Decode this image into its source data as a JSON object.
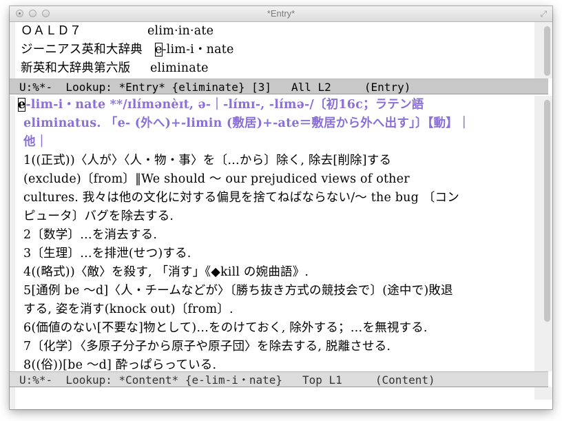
{
  "window": {
    "title": "*Entry*",
    "resize_icon": "resize-diagonal-icon"
  },
  "entry_pane": {
    "lines": [
      {
        "dict": "ＯＡＬＤ７",
        "word": "elim·in·ate"
      },
      {
        "dict": "ジーニアス英和大辞典",
        "word_cursor": "e",
        "word": "-lim-i・nate"
      },
      {
        "dict": "新英和大辞典第六版",
        "word": "eliminate"
      }
    ]
  },
  "modeline_entry": "U:%*-  Lookup: *Entry* {eliminate} [3]   All L2     (Entry)",
  "content_pane": {
    "head_cursor": "e",
    "head_rest": "-lim-i・nate **/ɪlímənèɪt, ə-｜-lɪ́mɪ-, -lɪ́mə-/〔初16c；ラテン語",
    "etym_line1": "eliminatus. 「e- (外へ)+-limin (敷居)+-ate＝敷居から外へ出す」〕【動】｜",
    "etym_line2": "他｜",
    "body_lines": [
      "1((正式))〈人が〉〈人・物・事〉を〔…から〕除く, 除去[削除]する",
      "(exclude)〔from〕‖We should 〜 our prejudiced views of other",
      "cultures. 我々は他の文化に対する偏見を捨てねばならない/〜 the bug 〔コン",
      "ピュータ〕バグを除去する.",
      "2〔数学〕…を消去する.",
      "3〔生理〕…を排泄(せつ)する.",
      "4((略式))〈敵〉を殺す, 「消す」《◆kill の婉曲語》.",
      "5[通例 be 〜d]〈人・チームなどが〉〔勝ち抜き方式の競技会で〕(途中で)敗退",
      "する, 姿を消す(knock out)〔from〕.",
      "6(価値のない[不要な]物として)…をのけておく, 除外する；…を無視する.",
      "7〔化学〕〈多原子分子から原子や原子団〉を除去する, 脱離させる.",
      "8((俗))[be 〜d] 酔っぱらっている."
    ]
  },
  "modeline_content": "U:%*-  Lookup: *Content* {e-lim-i・nate}   Top L1     (Content)",
  "colors": {
    "accent_purple": "#8a6fd6",
    "modeline_active": "#c8c8c8",
    "modeline_inactive": "#dcdcdc"
  }
}
